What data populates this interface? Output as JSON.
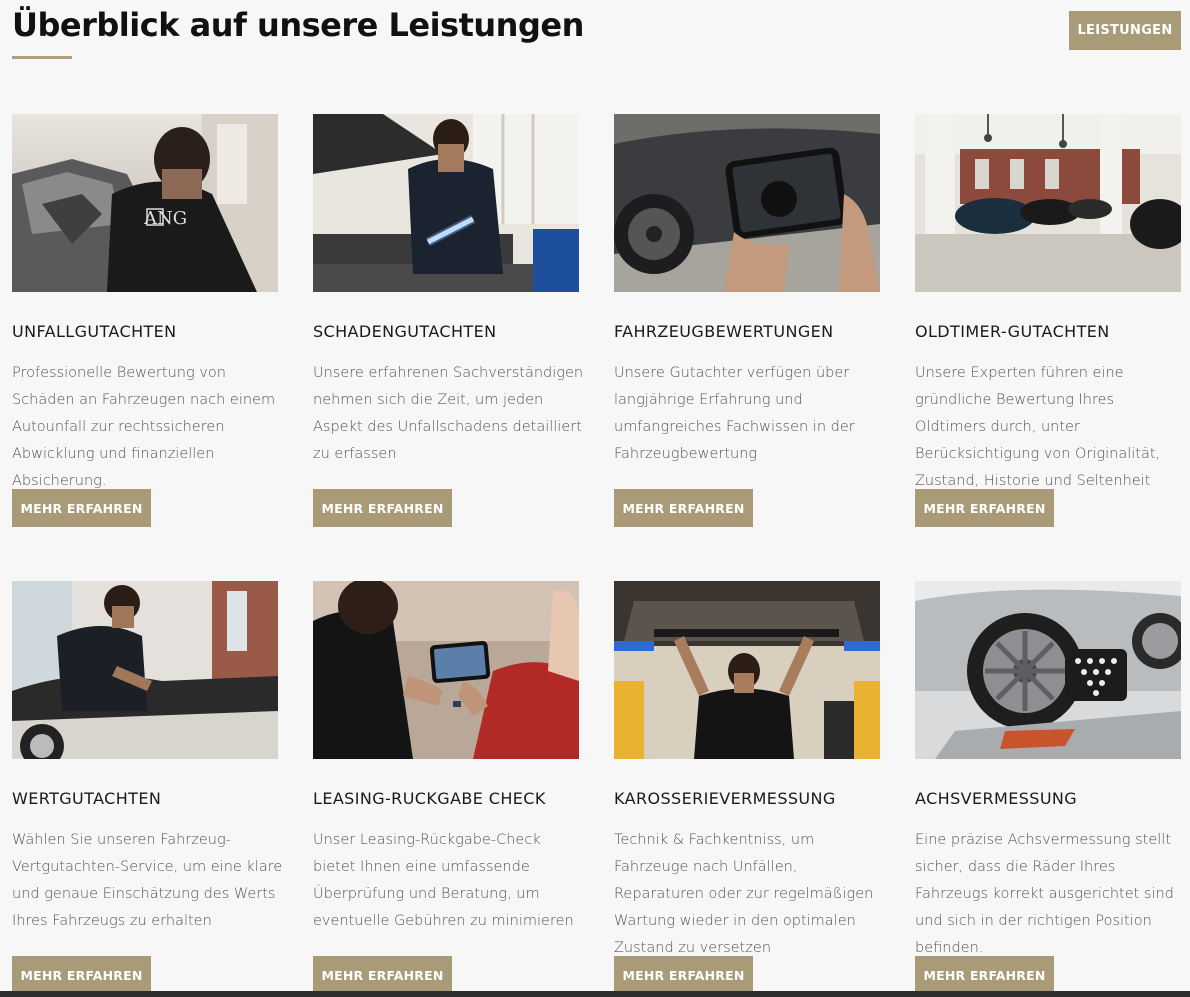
{
  "header": {
    "title": "Überblick auf unsere Leistungen",
    "button_label": "LEISTUNGEN"
  },
  "cards": [
    {
      "title": "UNFALLGUTACHTEN",
      "text": "Professionelle Bewertung von Schäden an Fahrzeugen nach einem Autounfall zur rechtssicheren Abwicklung und finanziellen Absicherung.",
      "button": "MEHR ERFAHREN",
      "image_logo": "ANG",
      "image": "person-with-damaged-car"
    },
    {
      "title": "SCHADENGUTACHTEN",
      "text": "Unsere erfahrenen Sachverständigen nehmen sich die Zeit, um jeden Aspekt des Unfallschadens detailliert zu erfassen",
      "button": "MEHR ERFAHREN",
      "image": "expert-inspecting-engine-with-light"
    },
    {
      "title": "FAHRZEUGBEWERTUNGEN",
      "text": "Unsere Gutachter verfügen über langjährige Erfahrung und umfangreiches Fachwissen in der Fahrzeugbewertung",
      "button": "MEHR ERFAHREN",
      "image": "tablet-photo-of-wheel"
    },
    {
      "title": "OLDTIMER-GUTACHTEN",
      "text": "Unsere Experten führen eine gründliche Bewertung Ihres Oldtimers durch, unter Berücksichtigung von Originalität, Zustand, Historie und Seltenheit",
      "button": "MEHR ERFAHREN",
      "image": "classic-cars-in-hall"
    },
    {
      "title": "WERTGUTACHTEN",
      "text": "Wählen Sie unseren Fahrzeug-Vertgutachten-Service, um eine klare und genaue Einschätzung des Werts Ihres Fahrzeugs zu erhalten",
      "button": "MEHR ERFAHREN",
      "image": "expert-writing-at-convertible"
    },
    {
      "title": "LEASING-RUCKGABE CHECK",
      "text": "Unser Leasing-Rückgabe-Check bietet Ihnen eine umfassende Überprüfung und Beratung, um eventuelle Gebühren zu minimieren",
      "button": "MEHR ERFAHREN",
      "image": "tablet-consultation"
    },
    {
      "title": "KAROSSERIEVERMESSUNG",
      "text": "Technik & Fachkentniss, um Fahrzeuge nach Unfällen, Reparaturen oder zur regelmäßigen Wartung wieder in den optimalen Zustand zu versetzen",
      "button": "MEHR ERFAHREN",
      "image": "mechanic-under-lifted-car"
    },
    {
      "title": "ACHSVERMESSUNG",
      "text": "Eine präzise Achsvermessung stellt sicher, dass die Räder Ihres Fahrzeugs korrekt ausgerichtet sind und sich in der richtigen Position befinden.",
      "button": "MEHR ERFAHREN",
      "image": "wheel-alignment-target"
    }
  ]
}
